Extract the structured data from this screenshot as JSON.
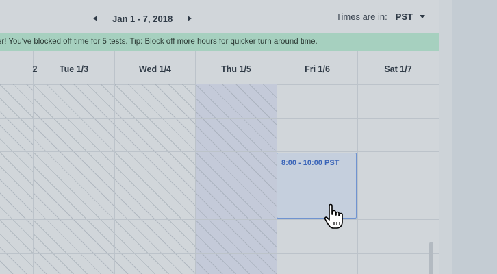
{
  "header": {
    "date_range": "Jan 1 - 7, 2018",
    "timezone_label": "Times are in:",
    "timezone_value": "PST"
  },
  "banner": {
    "text": "er! You've blocked off time for 5 tests. Tip: Block off more hours for quicker turn around time."
  },
  "calendar": {
    "days": [
      {
        "label": "2"
      },
      {
        "label": "Tue 1/3"
      },
      {
        "label": "Wed 1/4"
      },
      {
        "label": "Thu 1/5"
      },
      {
        "label": "Fri 1/6"
      },
      {
        "label": "Sat 1/7"
      }
    ],
    "events": [
      {
        "time": "8:00 - 10:00 PST",
        "day": "Fri 1/6"
      }
    ]
  },
  "icons": {
    "prev": "chevron-left-icon",
    "next": "chevron-right-icon",
    "dropdown": "caret-down-icon",
    "pointer": "hand-pointer-icon"
  },
  "colors": {
    "banner": "#a6d0bf",
    "today_column": "#c4cad9",
    "event_border": "#6f93d0",
    "event_text": "#3a64b8"
  }
}
